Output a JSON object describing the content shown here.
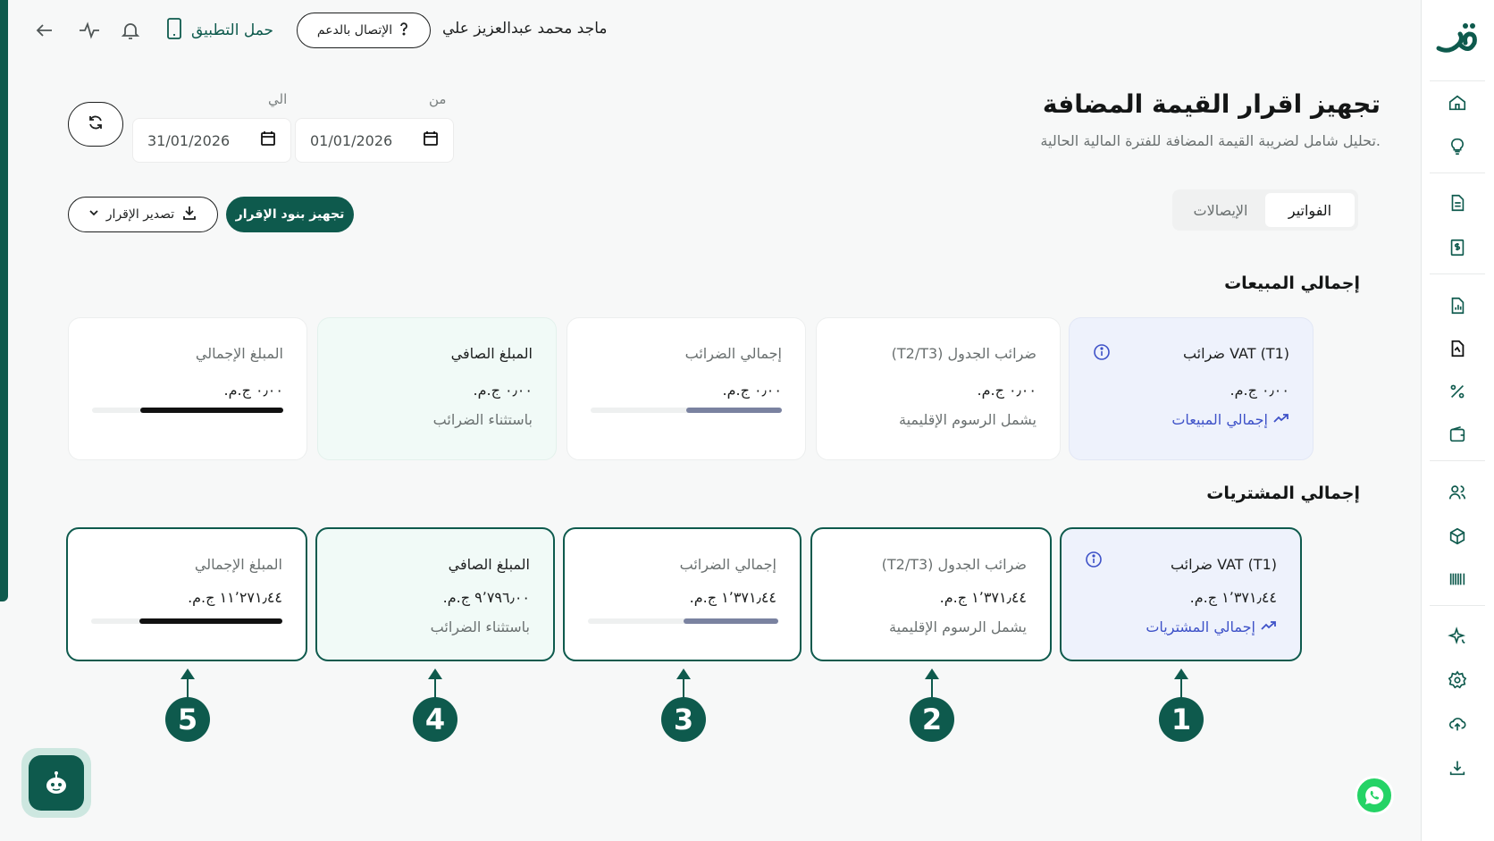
{
  "topbar": {
    "user_name": "ماجد محمد عبدالعزيز علي",
    "support_label": "الإتصال بالدعم",
    "support_icon": "question-icon",
    "download_app_label": "حمل التطبيق"
  },
  "page": {
    "title": "تجهيز اقرار القيمة المضافة",
    "subtitle": "تحليل شامل لضريبة القيمة المضافة للفترة المالية الحالية."
  },
  "dates": {
    "from_label": "من",
    "to_label": "الي",
    "from_value": "01/01/2026",
    "to_value": "31/01/2026"
  },
  "actions": {
    "prepare_label": "تجهيز بنود الإقرار",
    "export_label": "تصدير الإقرار"
  },
  "tabs": [
    {
      "label": "الفواتير",
      "active": true
    },
    {
      "label": "الإيصالات",
      "active": false
    }
  ],
  "sales": {
    "title": "إجمالي المبيعات",
    "cards": [
      {
        "label": "VAT (T1) ضرائب",
        "value": "٠٫٠٠ ج.م.",
        "link": "إجمالي المبيعات"
      },
      {
        "label": "ضرائب الجدول (T2/T3)",
        "value": "٠٫٠٠ ج.م.",
        "sub": "يشمل الرسوم الإقليمية"
      },
      {
        "label": "إجمالي الضرائب",
        "value": "٠٫٠٠ ج.م.",
        "progress": 0.5
      },
      {
        "label": "المبلغ الصافي",
        "value": "٠٫٠٠ ج.م.",
        "sub": "باستثناء الضرائب"
      },
      {
        "label": "المبلغ الإجمالي",
        "value": "٠٫٠٠ ج.م.",
        "progress": 0.75
      }
    ]
  },
  "purchases": {
    "title": "إجمالي المشتريات",
    "cards": [
      {
        "label": "VAT (T1) ضرائب",
        "value": "١٬٣٧١٫٤٤ ج.م.",
        "link": "إجمالي المشتريات"
      },
      {
        "label": "ضرائب الجدول (T2/T3)",
        "value": "١٬٣٧١٫٤٤ ج.م.",
        "sub": "يشمل الرسوم الإقليمية"
      },
      {
        "label": "إجمالي الضرائب",
        "value": "١٬٣٧١٫٤٤ ج.م.",
        "progress": 0.5
      },
      {
        "label": "المبلغ الصافي",
        "value": "٩٬٧٩٦٫٠٠ ج.م.",
        "sub": "باستثناء الضرائب"
      },
      {
        "label": "المبلغ الإجمالي",
        "value": "١١٬٢٧١٫٤٤ ج.م.",
        "progress": 0.75
      }
    ]
  },
  "markers": [
    "1",
    "2",
    "3",
    "4",
    "5"
  ],
  "colors": {
    "brand": "#0e5a4d",
    "link": "#3e52c8",
    "bar_light": "#7a82a0",
    "bar_dark": "#111111"
  }
}
